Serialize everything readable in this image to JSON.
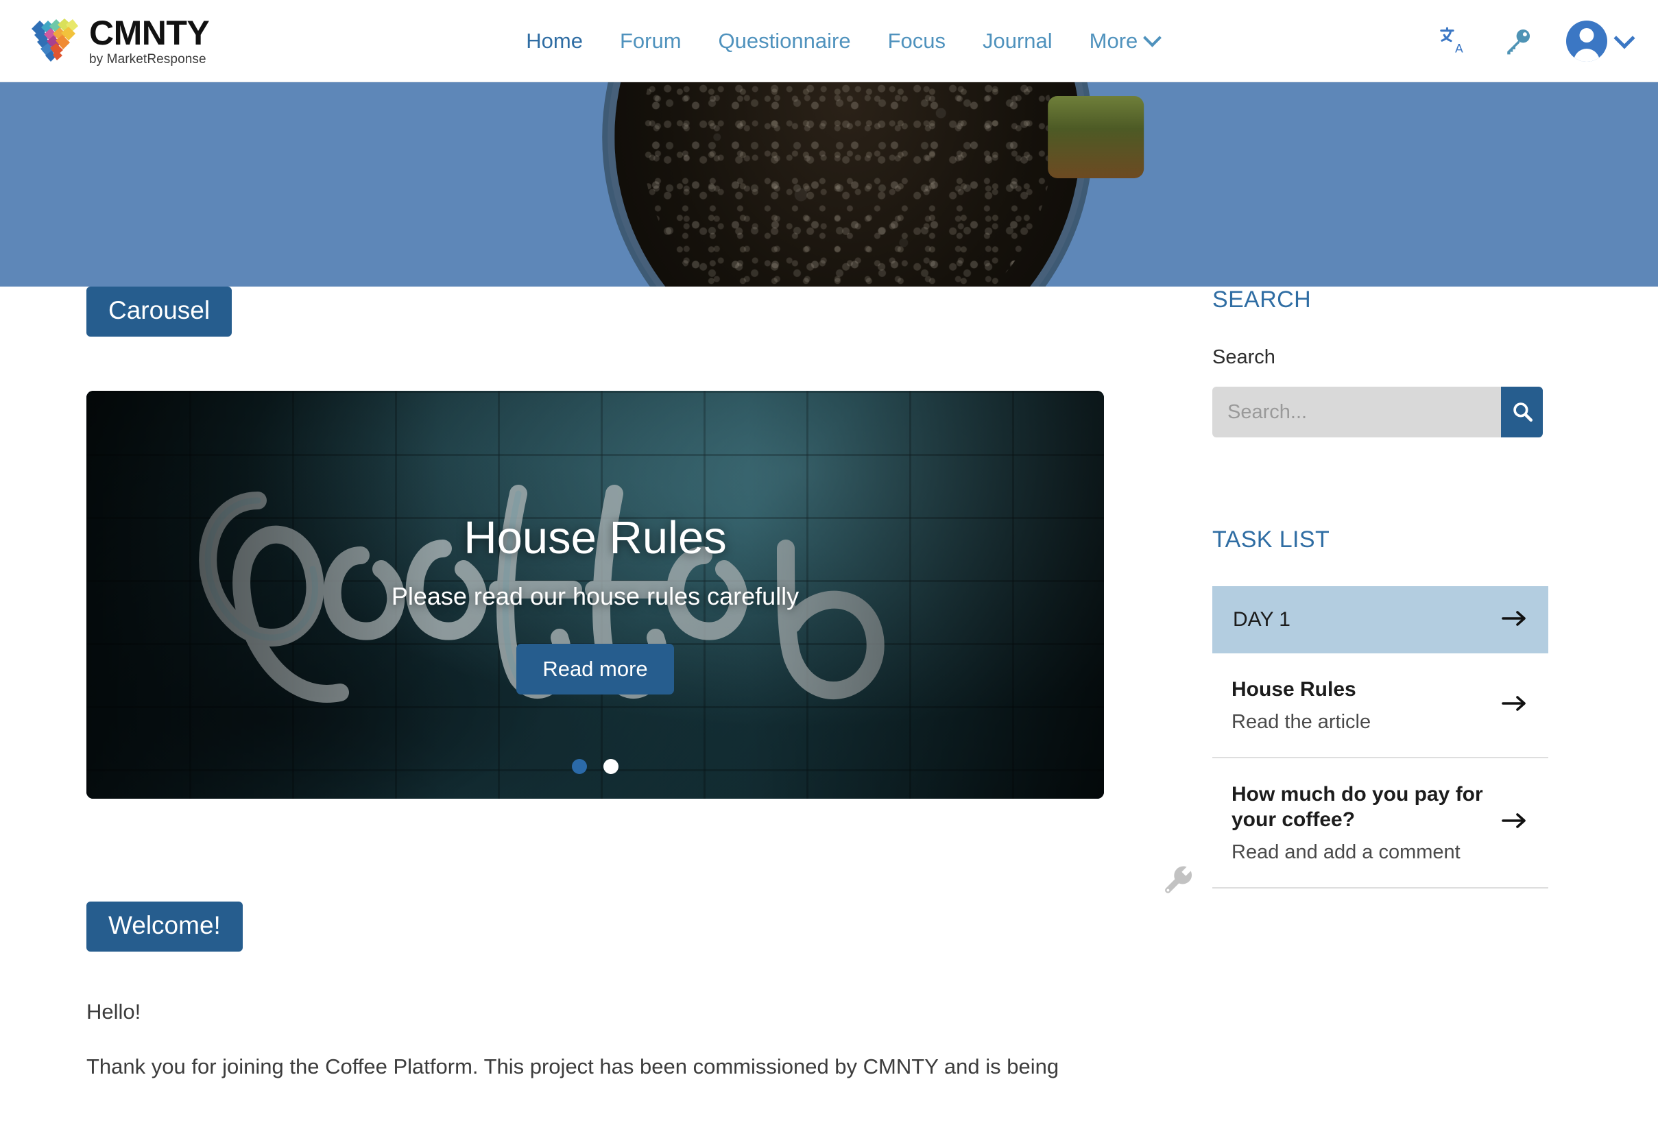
{
  "brand": {
    "name": "CMNTY",
    "tagline": "by MarketResponse",
    "logo_icon": "cmnty-diamond-logo"
  },
  "nav": {
    "items": [
      {
        "label": "Home",
        "active": true
      },
      {
        "label": "Forum",
        "active": false
      },
      {
        "label": "Questionnaire",
        "active": false
      },
      {
        "label": "Focus",
        "active": false
      },
      {
        "label": "Journal",
        "active": false
      },
      {
        "label": "More",
        "active": false,
        "caret": true
      }
    ],
    "icons": [
      {
        "name": "translate-icon",
        "glyph": "文"
      },
      {
        "name": "key-icon",
        "glyph": "key"
      },
      {
        "name": "user-avatar",
        "glyph": "person"
      }
    ]
  },
  "hero": {
    "image_alt": "coffee-cup-top-view",
    "background_color": "#5e87b8"
  },
  "carousel_section": {
    "badge": "Carousel",
    "slide": {
      "title": "House Rules",
      "subtitle": "Please read our house rules carefully",
      "button": "Read more",
      "image_alt": "neon-coffee-sign"
    },
    "dots": [
      {
        "active": false
      },
      {
        "active": true
      }
    ]
  },
  "welcome_section": {
    "badge": "Welcome!",
    "settings_icon": "wrench-icon",
    "paragraphs": [
      "Hello!",
      "Thank you for joining the Coffee Platform. This project has been commissioned by CMNTY and is being"
    ]
  },
  "sidebar": {
    "search": {
      "heading": "SEARCH",
      "label": "Search",
      "placeholder": "Search...",
      "value": "",
      "button_icon": "search-icon"
    },
    "task_list": {
      "heading": "TASK LIST",
      "day_header": {
        "label": "DAY 1",
        "arrow_icon": "arrow-right-icon"
      },
      "items": [
        {
          "title": "House Rules",
          "subtitle": "Read the article",
          "arrow_icon": "arrow-right-icon"
        },
        {
          "title": "How much do you pay for your coffee?",
          "subtitle": "Read and add a comment",
          "arrow_icon": "arrow-right-icon"
        }
      ]
    }
  },
  "colors": {
    "primary_blue": "#265d8e",
    "nav_blue": "#4f92bd",
    "nav_active_blue": "#2f6da3",
    "hero_blue": "#5e87b8",
    "day_row_blue": "#b3cde0",
    "avatar_blue": "#3b77c4",
    "input_gray": "#d9d9d9"
  }
}
